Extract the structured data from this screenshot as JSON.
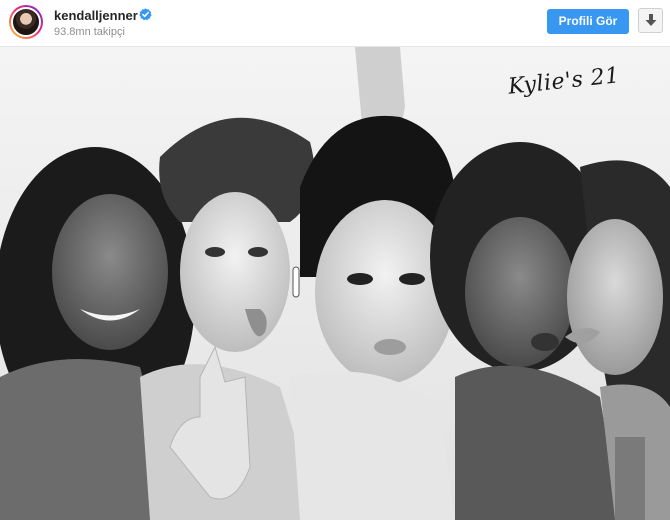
{
  "header": {
    "username": "kendalljenner",
    "followers": "93.8mn takipçi",
    "profile_button": "Profili Gör",
    "verified_icon": "verified-badge-icon",
    "download_icon": "download-arrow-icon"
  },
  "photo": {
    "overlay_text": "Kylie's 21",
    "style": "black-and-white group photo"
  },
  "colors": {
    "accent": "#3897f0",
    "verified": "#3897f0",
    "username": "#262626",
    "secondary_text": "#8e8e8e"
  }
}
